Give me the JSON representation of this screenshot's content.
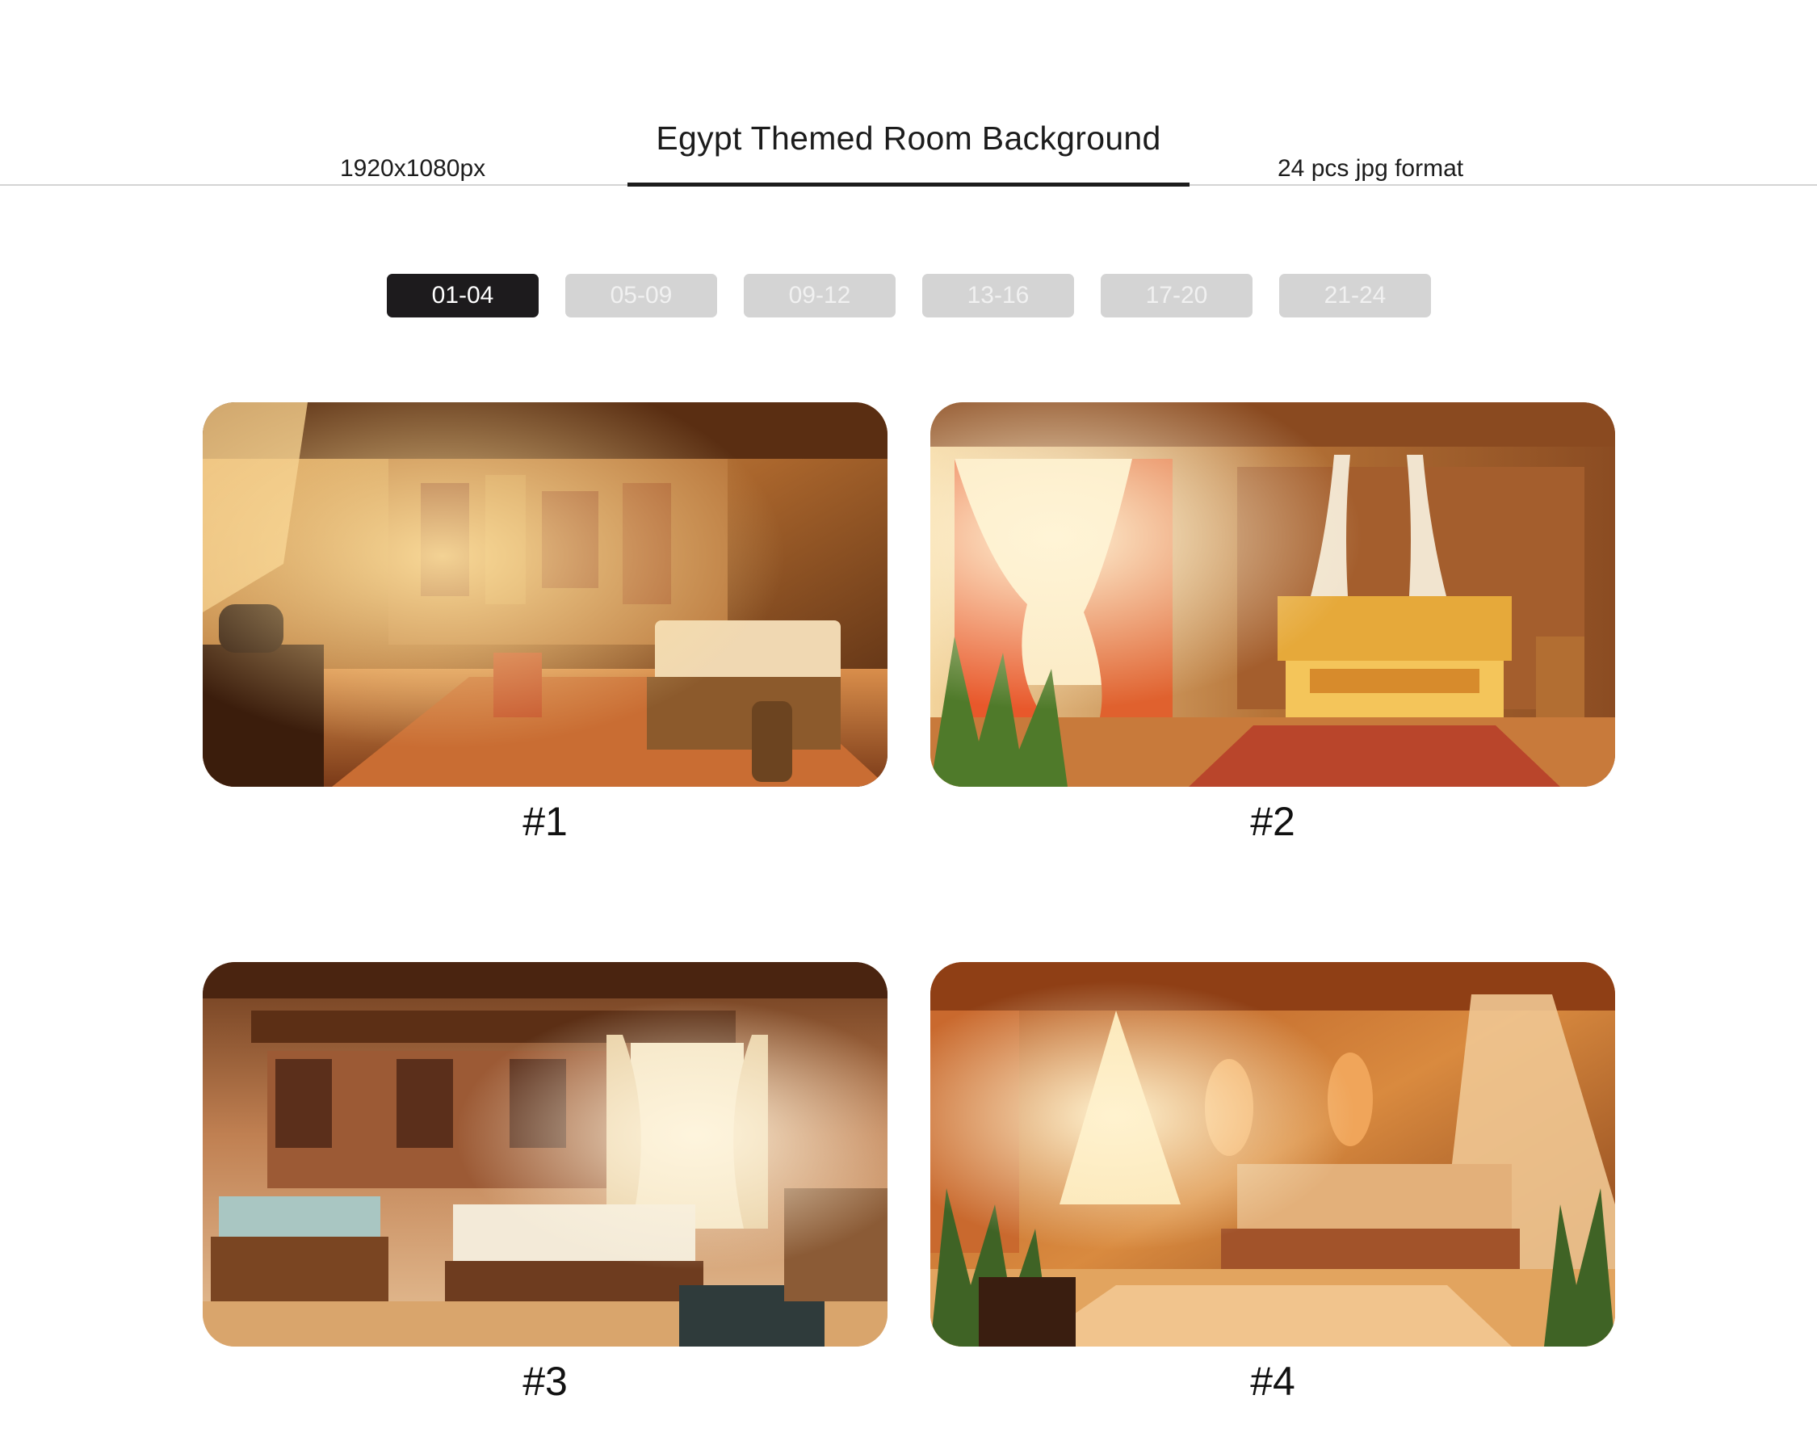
{
  "header": {
    "title": "Egypt Themed Room Background",
    "resolution": "1920x1080px",
    "format": "24 pcs jpg format"
  },
  "tabs": [
    {
      "label": "01-04",
      "active": true
    },
    {
      "label": "05-09",
      "active": false
    },
    {
      "label": "09-12",
      "active": false
    },
    {
      "label": "13-16",
      "active": false
    },
    {
      "label": "17-20",
      "active": false
    },
    {
      "label": "21-24",
      "active": false
    }
  ],
  "gallery": {
    "items": [
      {
        "label": "#1"
      },
      {
        "label": "#2"
      },
      {
        "label": "#3"
      },
      {
        "label": "#4"
      }
    ]
  },
  "colors": {
    "accent": "#1d1b1d",
    "tab_inactive": "#d4d4d4",
    "divider": "#d4d4d4"
  }
}
